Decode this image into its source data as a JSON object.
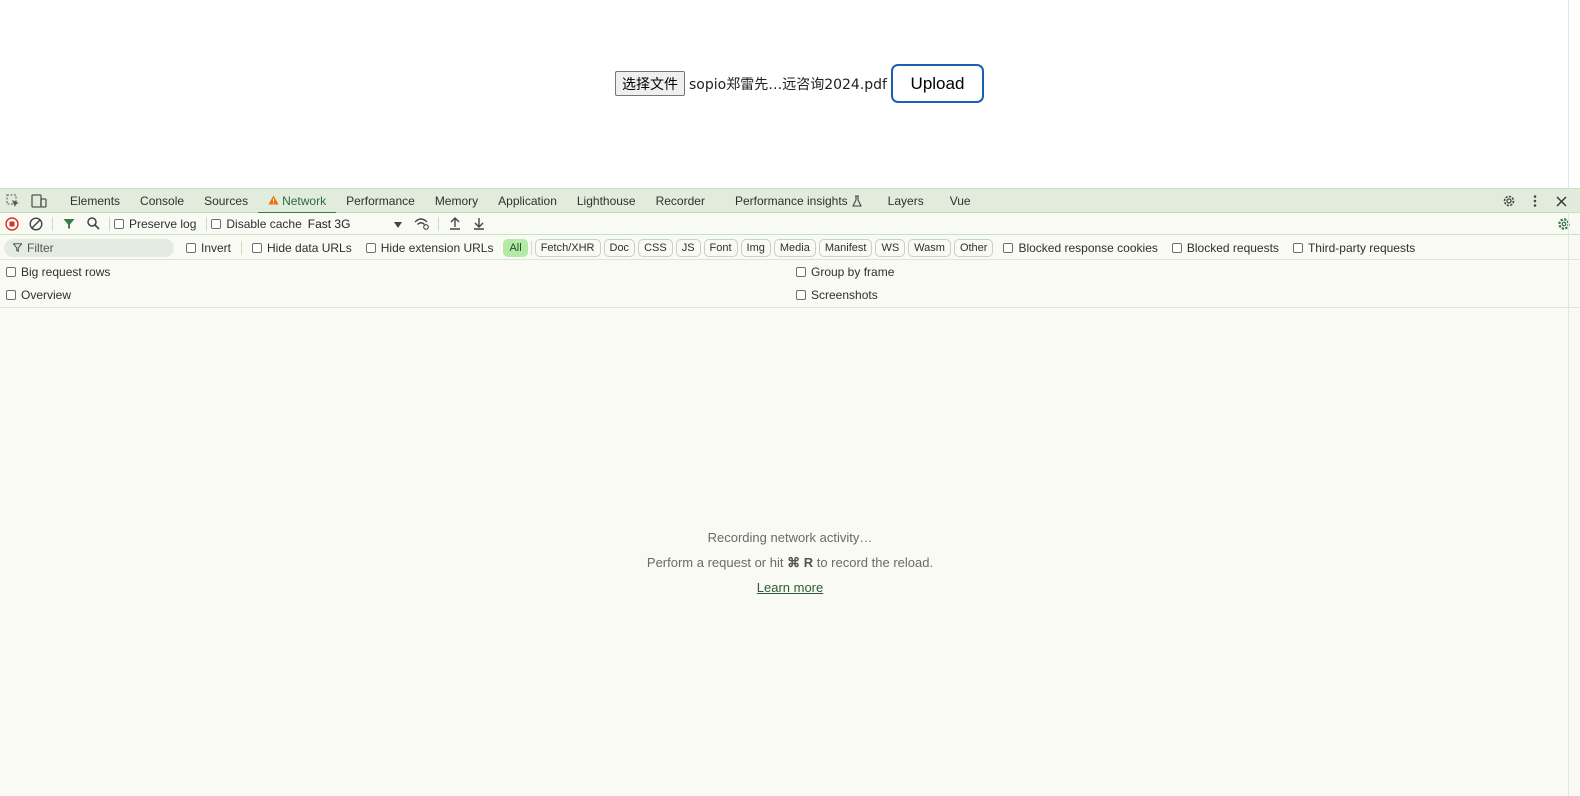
{
  "page": {
    "choose_file_label": "选择文件",
    "file_name": "sopio郑雷先…远咨询2024.pdf",
    "upload_label": "Upload"
  },
  "devtools": {
    "tabs": [
      {
        "label": "Elements"
      },
      {
        "label": "Console"
      },
      {
        "label": "Sources"
      },
      {
        "label": "Network",
        "active": true,
        "warning": true
      },
      {
        "label": "Performance"
      },
      {
        "label": "Memory"
      },
      {
        "label": "Application"
      },
      {
        "label": "Lighthouse"
      },
      {
        "label": "Recorder"
      },
      {
        "label": "Performance insights"
      },
      {
        "label": "Layers"
      },
      {
        "label": "Vue"
      }
    ],
    "toolbar": {
      "preserve_log": "Preserve log",
      "disable_cache": "Disable cache",
      "throttle_value": "Fast 3G"
    },
    "filter": {
      "placeholder": "Filter",
      "invert": "Invert",
      "hide_data_urls": "Hide data URLs",
      "hide_extension_urls": "Hide extension URLs",
      "types": [
        "All",
        "Fetch/XHR",
        "Doc",
        "CSS",
        "JS",
        "Font",
        "Img",
        "Media",
        "Manifest",
        "WS",
        "Wasm",
        "Other"
      ],
      "active_type": "All",
      "blocked_response_cookies": "Blocked response cookies",
      "blocked_requests": "Blocked requests",
      "third_party_requests": "Third-party requests"
    },
    "options": {
      "big_request_rows": "Big request rows",
      "group_by_frame": "Group by frame",
      "overview": "Overview",
      "screenshots": "Screenshots"
    },
    "empty_state": {
      "line1": "Recording network activity…",
      "line2_prefix": "Perform a request or hit",
      "shortcut": "⌘ R",
      "line2_suffix": "to record the reload.",
      "learn_more": "Learn more"
    },
    "colors": {
      "accent": "#3b7d4a",
      "tabbar_bg": "#e1ecdc",
      "panel_bg": "#f8faf3",
      "record_red": "#d93025",
      "warning_orange": "#e8710a"
    }
  }
}
